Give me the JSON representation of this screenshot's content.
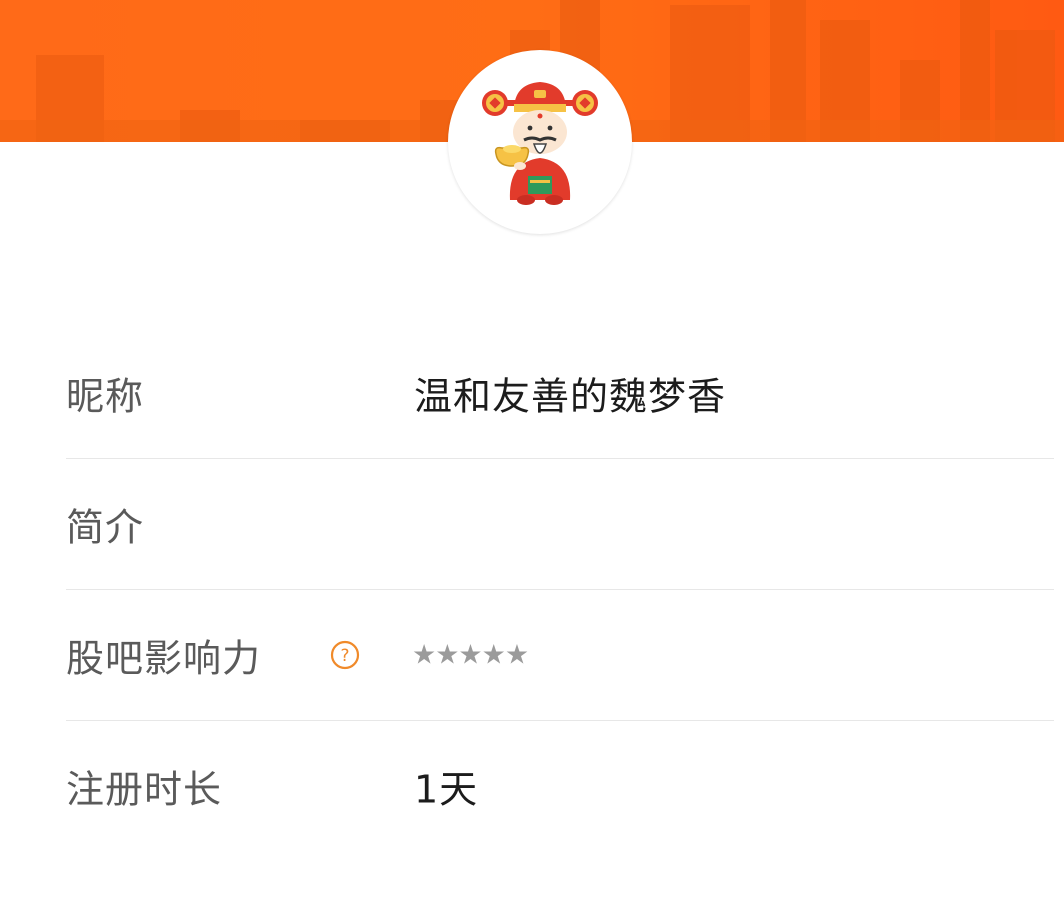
{
  "profile": {
    "avatar_icon": "god-of-wealth-avatar-icon",
    "nickname_label": "昵称",
    "nickname_value": "温和友善的魏梦香",
    "intro_label": "简介",
    "intro_value": "",
    "influence_label": "股吧影响力",
    "influence_help_icon": "question-circle-icon",
    "influence_stars": "★★★★★",
    "influence_rating": 0,
    "register_label": "注册时长",
    "register_value": "1天"
  },
  "colors": {
    "banner": "#ff6a18",
    "help_icon": "#f08a2a",
    "label_text": "#5a5a5a",
    "value_text": "#1c1c1c",
    "stars": "#9b9b9b",
    "divider": "#e7e7e7"
  }
}
